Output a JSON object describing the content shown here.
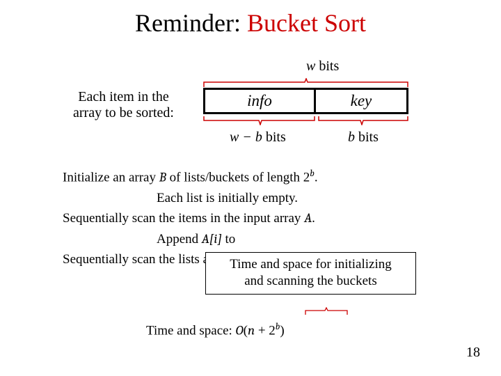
{
  "title": {
    "part1": "Reminder: ",
    "part2": "Bucket Sort"
  },
  "diagram": {
    "w_bits": {
      "var": "w",
      "word": " bits"
    },
    "item_label_l1": "Each item in the",
    "item_label_l2": "array to be sorted:",
    "info": "info",
    "key": "key",
    "w_minus_b": {
      "expr": "w − b",
      "word": " bits"
    },
    "b_bits": {
      "var": "b",
      "word": " bits"
    }
  },
  "body": {
    "l1a": "Initialize an array ",
    "l1b": "B",
    "l1c": " of lists/buckets of length ",
    "l1d_base": "2",
    "l1d_exp": "b",
    "l1e": ".",
    "l2": "Each list is initially empty.",
    "l3a": "Sequentially scan the items in the input array ",
    "l3b": "A",
    "l3c": ".",
    "l4a": "Append ",
    "l4b": "A[i]",
    "l4c": " to",
    "l5": "Sequentially scan the lists an"
  },
  "callout": {
    "l1": "Time and space for initializing",
    "l2": "and scanning the buckets"
  },
  "ts": {
    "label": "Time and space:    ",
    "O": "O",
    "open": "(",
    "n": "n",
    "plus": " + ",
    "base": "2",
    "exp": "b",
    "close": ")"
  },
  "slide_number": "18"
}
